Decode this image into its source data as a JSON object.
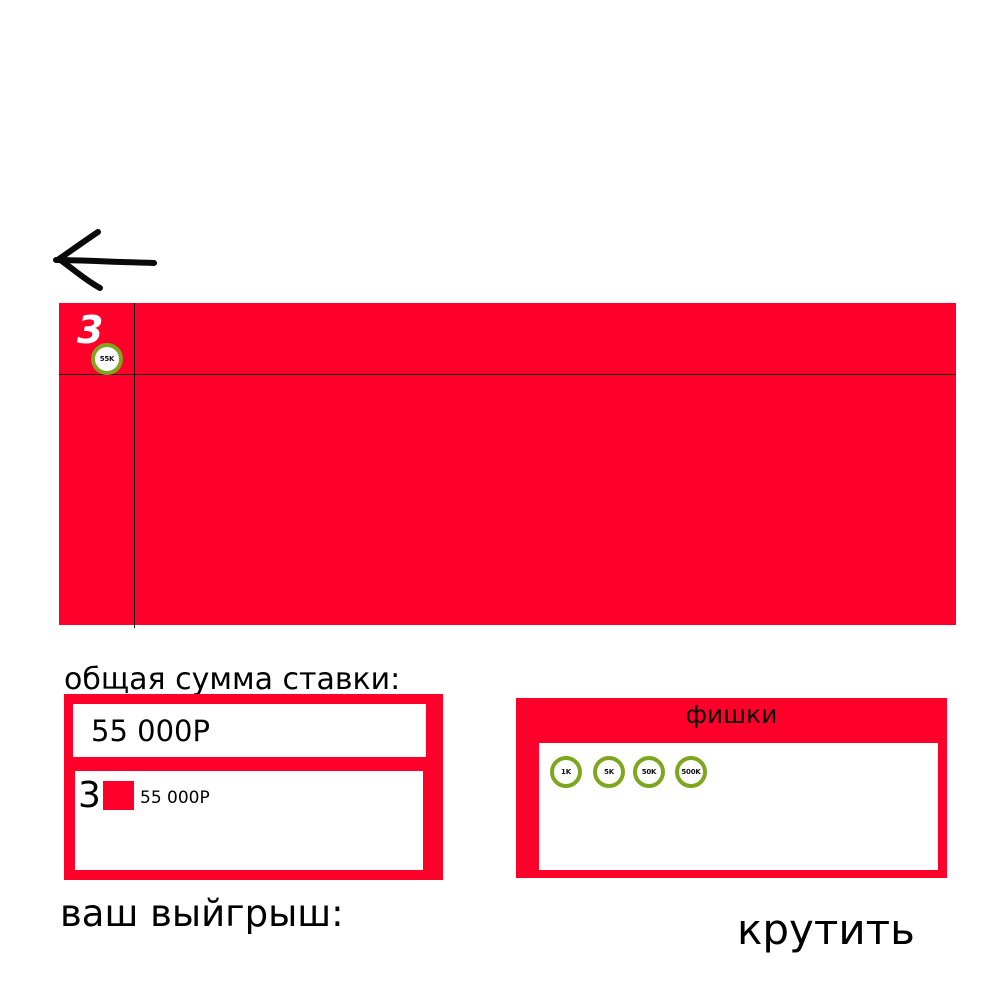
{
  "board": {
    "cell_number": "3",
    "placed_chip": "55K"
  },
  "total_bet": {
    "label": "общая сумма ставки:",
    "value": "55 000Р"
  },
  "bets": [
    {
      "number": "3",
      "color": "#ff002b",
      "amount": "55 000Р"
    }
  ],
  "chips": {
    "title": "фишки",
    "items": [
      "1K",
      "5K",
      "50K",
      "500K"
    ]
  },
  "winnings": {
    "label": "ваш выйгрыш:"
  },
  "spin_label": "крутить",
  "colors": {
    "table_red": "#ff002b",
    "chip_ring": "#7ea61e"
  },
  "icons": {
    "back": "arrow-left-icon"
  }
}
